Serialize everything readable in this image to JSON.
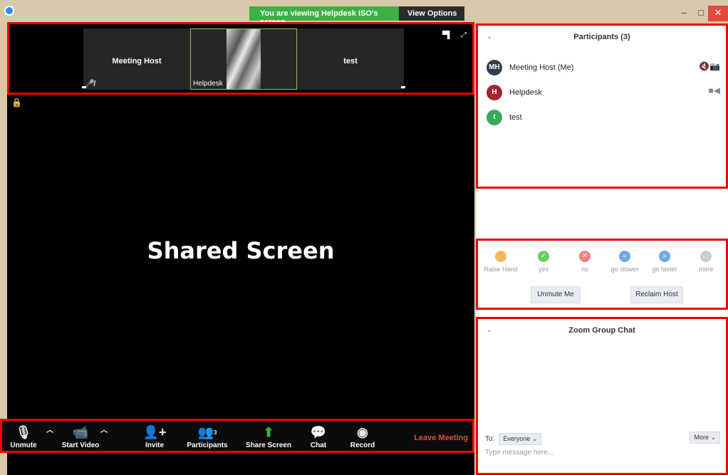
{
  "titlebar": {
    "banner": "You are viewing Helpdesk ISO's screen",
    "view_options": "View Options ⌄",
    "min": "–",
    "max": "□",
    "close": "✕"
  },
  "video_strip": {
    "tiles": [
      {
        "name": "Meeting Host"
      },
      {
        "name": "Helpdesk"
      },
      {
        "name": "test"
      }
    ]
  },
  "main": {
    "label": "Shared Screen"
  },
  "toolbar": {
    "unmute": "Unmute",
    "start_video": "Start Video",
    "invite": "Invite",
    "participants": "Participants",
    "participants_count": "3",
    "share_screen": "Share Screen",
    "chat": "Chat",
    "record": "Record",
    "leave": "Leave Meeting"
  },
  "participants": {
    "title": "Participants (3)",
    "list": [
      {
        "initials": "MH",
        "name": "Meeting Host (Me)",
        "color": "#2d3e50"
      },
      {
        "initials": "H",
        "name": "Helpdesk",
        "color": "#a4232c"
      },
      {
        "initials": "t",
        "name": "test",
        "color": "#3aa957"
      }
    ]
  },
  "reactions": {
    "items": [
      {
        "label": "Raise Hand",
        "icon": "raise-hand-icon",
        "color": "#f5b67a"
      },
      {
        "label": "yes",
        "icon": "check-icon",
        "color": "#6ccb6c"
      },
      {
        "label": "no",
        "icon": "x-icon",
        "color": "#f08080"
      },
      {
        "label": "go slower",
        "icon": "rewind-icon",
        "color": "#6fa8e8"
      },
      {
        "label": "go faster",
        "icon": "fast-forward-icon",
        "color": "#6fa8e8"
      },
      {
        "label": "more",
        "icon": "ellipsis-icon",
        "color": "#c8ccd6"
      }
    ],
    "unmute_me": "Unmute Me",
    "reclaim_host": "Reclaim Host"
  },
  "chat": {
    "title": "Zoom Group Chat",
    "to_label": "To:",
    "recipient": "Everyone ⌄",
    "more": "More ⌄",
    "placeholder": "Type message here..."
  }
}
